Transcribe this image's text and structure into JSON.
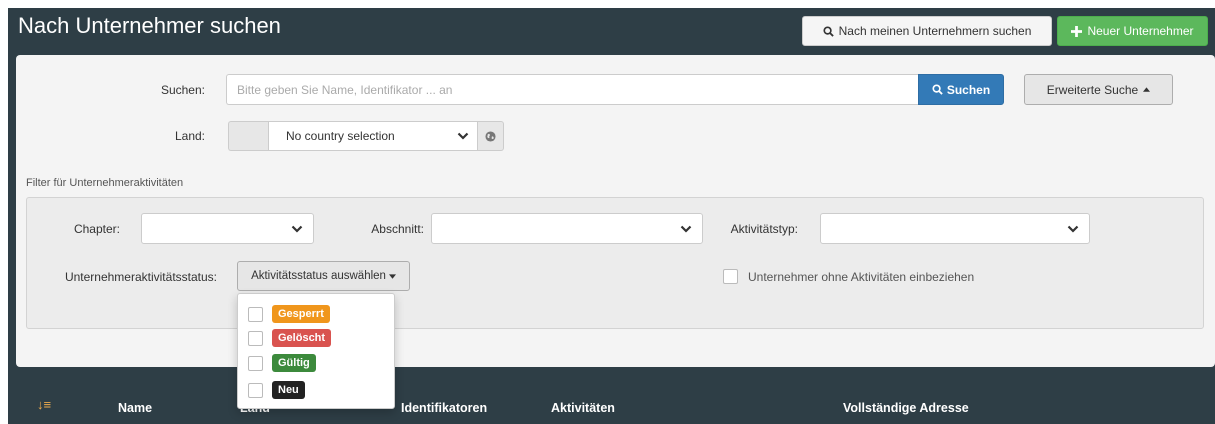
{
  "header": {
    "title": "Nach Unternehmer suchen",
    "my_search_label": "Nach meinen Unternehmern suchen",
    "new_label": "Neuer Unternehmer"
  },
  "search": {
    "label": "Suchen:",
    "placeholder": "Bitte geben Sie Name, Identifikator ... an",
    "button_label": "Suchen",
    "advanced_label": "Erweiterte Suche"
  },
  "country": {
    "label": "Land:",
    "value": "No country selection"
  },
  "filter": {
    "section_title": "Filter für Unternehmeraktivitäten",
    "chapter_label": "Chapter:",
    "section_label": "Abschnitt:",
    "activity_type_label": "Aktivitätstyp:",
    "status_label": "Unternehmeraktivitätsstatus:",
    "status_button_label": "Aktivitätsstatus auswählen",
    "include_without_label": "Unternehmer ohne Aktivitäten einbeziehen"
  },
  "status_options": [
    {
      "label": "Gesperrt",
      "color": "#f0961c"
    },
    {
      "label": "Gelöscht",
      "color": "#d9534f"
    },
    {
      "label": "Gültig",
      "color": "#3c8a3c"
    },
    {
      "label": "Neu",
      "color": "#222222"
    }
  ],
  "table": {
    "columns": [
      "Name",
      "Land",
      "Identifikatoren",
      "Aktivitäten",
      "Vollständige Adresse"
    ]
  },
  "colors": {
    "dark_header": "#2e3e46",
    "primary": "#337ab7",
    "success": "#5cb85c"
  },
  "icons": [
    "search-icon",
    "plus-icon",
    "chevron-down-icon",
    "globe-icon",
    "caret-up-icon",
    "caret-down-icon",
    "sort-icon"
  ]
}
